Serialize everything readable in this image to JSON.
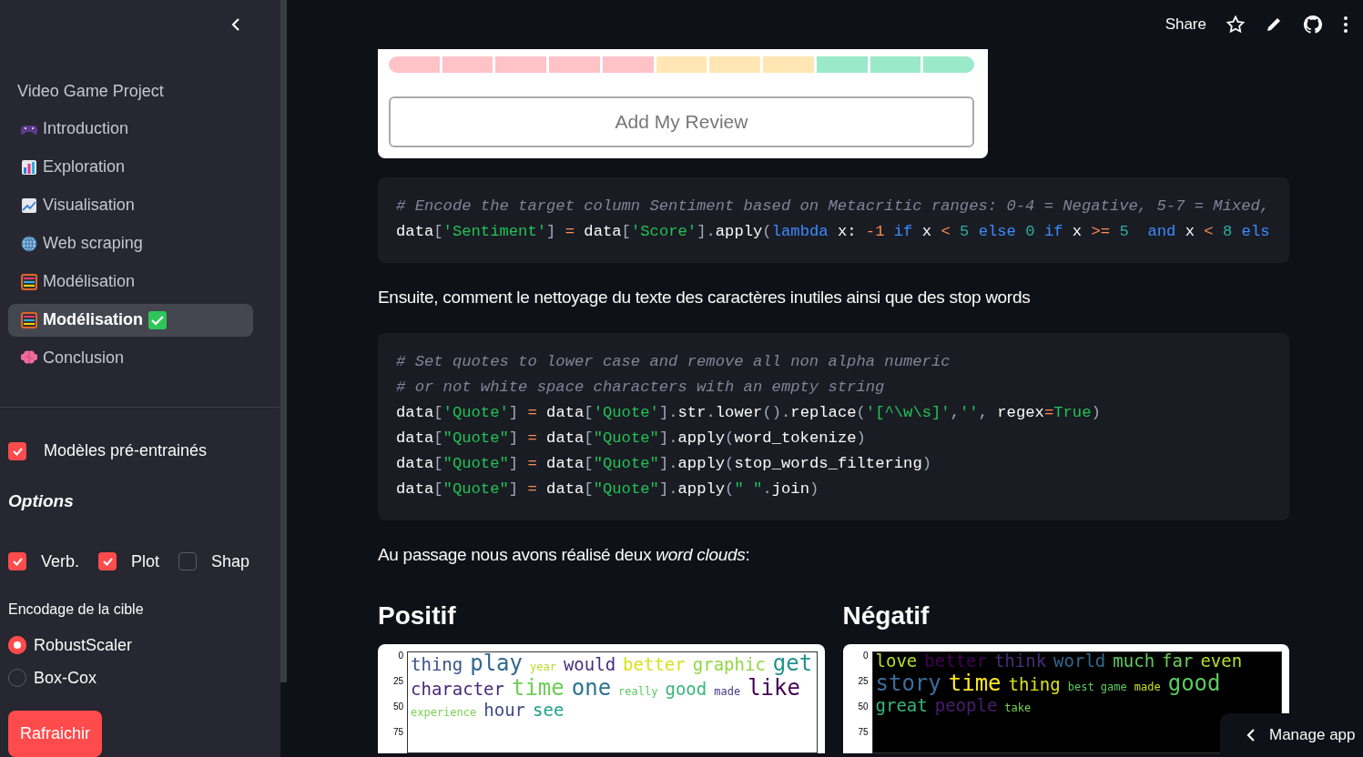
{
  "sidebar": {
    "title": "Video Game Project",
    "nav": [
      {
        "label": "Introduction",
        "selected": false,
        "done": false
      },
      {
        "label": "Exploration",
        "selected": false,
        "done": false
      },
      {
        "label": "Visualisation",
        "selected": false,
        "done": false
      },
      {
        "label": "Web scraping",
        "selected": false,
        "done": false
      },
      {
        "label": "Modélisation",
        "selected": false,
        "done": false
      },
      {
        "label": "Modélisation",
        "selected": true,
        "done": true
      },
      {
        "label": "Conclusion",
        "selected": false,
        "done": false
      }
    ],
    "pretrained": {
      "label": "Modèles pré-entrainés",
      "checked": true
    },
    "options_title": "Options",
    "options": [
      {
        "label": "Verb.",
        "checked": true
      },
      {
        "label": "Plot",
        "checked": true
      },
      {
        "label": "Shap",
        "checked": false
      }
    ],
    "encoding": {
      "label": "Encodage de la cible",
      "choices": [
        {
          "label": "RobustScaler",
          "selected": true
        },
        {
          "label": "Box-Cox",
          "selected": false
        }
      ]
    },
    "refresh_button": "Rafraichir"
  },
  "header": {
    "share": "Share"
  },
  "review": {
    "segments": [
      {
        "color": "#ffc2c7"
      },
      {
        "color": "#ffc2c7"
      },
      {
        "color": "#ffc2c7"
      },
      {
        "color": "#ffc2c7"
      },
      {
        "color": "#ffc2c7"
      },
      {
        "color": "#ffe6b3"
      },
      {
        "color": "#ffe6b3"
      },
      {
        "color": "#ffe6b3"
      },
      {
        "color": "#9ae9c9"
      },
      {
        "color": "#9ae9c9"
      },
      {
        "color": "#9ae9c9"
      }
    ],
    "button": "Add My Review"
  },
  "code_blocks": [
    {
      "lines": [
        [
          {
            "kind": "comment",
            "text": "# Encode the target column Sentiment based on Metacritic ranges: 0-4 = Negative, 5-7 = Mixed,"
          }
        ],
        [
          {
            "kind": "name",
            "text": "data"
          },
          {
            "kind": "punct",
            "text": "["
          },
          {
            "kind": "string",
            "text": "'Sentiment'"
          },
          {
            "kind": "punct",
            "text": "]"
          },
          {
            "kind": "op",
            "text": " = "
          },
          {
            "kind": "name",
            "text": "data"
          },
          {
            "kind": "punct",
            "text": "["
          },
          {
            "kind": "string",
            "text": "'Score'"
          },
          {
            "kind": "punct",
            "text": "]."
          },
          {
            "kind": "name",
            "text": "apply"
          },
          {
            "kind": "punct",
            "text": "("
          },
          {
            "kind": "keyword",
            "text": "lambda"
          },
          {
            "kind": "name",
            "text": " x: "
          },
          {
            "kind": "op",
            "text": "-1"
          },
          {
            "kind": "keyword",
            "text": " if"
          },
          {
            "kind": "name",
            "text": " x "
          },
          {
            "kind": "op",
            "text": "<"
          },
          {
            "kind": "number",
            "text": " 5"
          },
          {
            "kind": "keyword",
            "text": " else"
          },
          {
            "kind": "number",
            "text": " 0"
          },
          {
            "kind": "keyword",
            "text": " if"
          },
          {
            "kind": "name",
            "text": " x "
          },
          {
            "kind": "op",
            "text": ">="
          },
          {
            "kind": "number",
            "text": " 5"
          },
          {
            "kind": "keyword",
            "text": "  and"
          },
          {
            "kind": "name",
            "text": " x "
          },
          {
            "kind": "op",
            "text": "<"
          },
          {
            "kind": "number",
            "text": " 8"
          },
          {
            "kind": "keyword",
            "text": " els"
          }
        ]
      ]
    },
    {
      "lines": [
        [
          {
            "kind": "comment",
            "text": "# Set quotes to lower case and remove all non alpha numeric"
          }
        ],
        [
          {
            "kind": "comment",
            "text": "# or not white space characters with an empty string"
          }
        ],
        [
          {
            "kind": "name",
            "text": "data"
          },
          {
            "kind": "punct",
            "text": "["
          },
          {
            "kind": "string",
            "text": "'Quote'"
          },
          {
            "kind": "punct",
            "text": "]"
          },
          {
            "kind": "op",
            "text": " = "
          },
          {
            "kind": "name",
            "text": "data"
          },
          {
            "kind": "punct",
            "text": "["
          },
          {
            "kind": "string",
            "text": "'Quote'"
          },
          {
            "kind": "punct",
            "text": "]."
          },
          {
            "kind": "name",
            "text": "str"
          },
          {
            "kind": "punct",
            "text": "."
          },
          {
            "kind": "name",
            "text": "lower"
          },
          {
            "kind": "punct",
            "text": "()."
          },
          {
            "kind": "name",
            "text": "replace"
          },
          {
            "kind": "punct",
            "text": "("
          },
          {
            "kind": "string",
            "text": "'[^\\w\\s]'"
          },
          {
            "kind": "punct",
            "text": ","
          },
          {
            "kind": "string",
            "text": "''"
          },
          {
            "kind": "punct",
            "text": ", "
          },
          {
            "kind": "name",
            "text": "regex"
          },
          {
            "kind": "op",
            "text": "="
          },
          {
            "kind": "string",
            "text": "True"
          },
          {
            "kind": "punct",
            "text": ")"
          }
        ],
        [
          {
            "kind": "name",
            "text": "data"
          },
          {
            "kind": "punct",
            "text": "["
          },
          {
            "kind": "string",
            "text": "\"Quote\""
          },
          {
            "kind": "punct",
            "text": "]"
          },
          {
            "kind": "op",
            "text": " = "
          },
          {
            "kind": "name",
            "text": "data"
          },
          {
            "kind": "punct",
            "text": "["
          },
          {
            "kind": "string",
            "text": "\"Quote\""
          },
          {
            "kind": "punct",
            "text": "]."
          },
          {
            "kind": "name",
            "text": "apply"
          },
          {
            "kind": "punct",
            "text": "("
          },
          {
            "kind": "name",
            "text": "word_tokenize"
          },
          {
            "kind": "punct",
            "text": ")"
          }
        ],
        [
          {
            "kind": "name",
            "text": "data"
          },
          {
            "kind": "punct",
            "text": "["
          },
          {
            "kind": "string",
            "text": "\"Quote\""
          },
          {
            "kind": "punct",
            "text": "]"
          },
          {
            "kind": "op",
            "text": " = "
          },
          {
            "kind": "name",
            "text": "data"
          },
          {
            "kind": "punct",
            "text": "["
          },
          {
            "kind": "string",
            "text": "\"Quote\""
          },
          {
            "kind": "punct",
            "text": "]."
          },
          {
            "kind": "name",
            "text": "apply"
          },
          {
            "kind": "punct",
            "text": "("
          },
          {
            "kind": "name",
            "text": "stop_words_filtering"
          },
          {
            "kind": "punct",
            "text": ")"
          }
        ],
        [
          {
            "kind": "name",
            "text": "data"
          },
          {
            "kind": "punct",
            "text": "["
          },
          {
            "kind": "string",
            "text": "\"Quote\""
          },
          {
            "kind": "punct",
            "text": "]"
          },
          {
            "kind": "op",
            "text": " = "
          },
          {
            "kind": "name",
            "text": "data"
          },
          {
            "kind": "punct",
            "text": "["
          },
          {
            "kind": "string",
            "text": "\"Quote\""
          },
          {
            "kind": "punct",
            "text": "]."
          },
          {
            "kind": "name",
            "text": "apply"
          },
          {
            "kind": "punct",
            "text": "("
          },
          {
            "kind": "string",
            "text": "\" \""
          },
          {
            "kind": "punct",
            "text": "."
          },
          {
            "kind": "name",
            "text": "join"
          },
          {
            "kind": "punct",
            "text": ")"
          }
        ]
      ]
    }
  ],
  "paragraphs": [
    "Ensuite, comment le nettoyage du texte des caractères inutiles ainsi que des stop words",
    "Au passage nous avons réalisé deux *word clouds*:"
  ],
  "wordclouds": [
    {
      "heading": "Positif",
      "ticks": [
        "0",
        "25",
        "50",
        "75"
      ],
      "words": [
        {
          "text": "thing",
          "kind": "mid",
          "color": "#3b528b"
        },
        {
          "text": "play",
          "kind": "big",
          "color": "#31688e"
        },
        {
          "text": "year",
          "kind": "small",
          "color": "#b5de2b"
        },
        {
          "text": "would",
          "kind": "mid",
          "color": "#472d7b"
        },
        {
          "text": "better",
          "kind": "mid",
          "color": "#d8e219"
        },
        {
          "text": "graphic",
          "kind": "mid",
          "color": "#90d743"
        },
        {
          "text": "get",
          "kind": "big",
          "color": "#21918c"
        },
        {
          "text": "character",
          "kind": "mid",
          "color": "#482878"
        },
        {
          "text": "time",
          "kind": "big",
          "color": "#6ece58"
        },
        {
          "text": "one",
          "kind": "big",
          "color": "#2c728e"
        },
        {
          "text": "really",
          "kind": "small",
          "color": "#5ec962"
        },
        {
          "text": "good",
          "kind": "mid",
          "color": "#35b779"
        },
        {
          "text": "made",
          "kind": "small",
          "color": "#443983"
        },
        {
          "text": "like",
          "kind": "big",
          "color": "#440154"
        },
        {
          "text": "experience",
          "kind": "small",
          "color": "#7ad151"
        },
        {
          "text": "hour",
          "kind": "mid",
          "color": "#3e4989"
        },
        {
          "text": "see",
          "kind": "mid",
          "color": "#1fa187"
        }
      ]
    },
    {
      "heading": "Négatif",
      "ticks": [
        "0",
        "25",
        "50",
        "75"
      ],
      "words": [
        {
          "text": "love",
          "kind": "mid",
          "color": "#b5de2b"
        },
        {
          "text": "better",
          "kind": "mid",
          "color": "#440154"
        },
        {
          "text": "think",
          "kind": "mid",
          "color": "#472d7b"
        },
        {
          "text": "world",
          "kind": "mid",
          "color": "#31688e"
        },
        {
          "text": "much",
          "kind": "mid",
          "color": "#5ec962"
        },
        {
          "text": "far",
          "kind": "mid",
          "color": "#6ece58"
        },
        {
          "text": "even",
          "kind": "mid",
          "color": "#b5de2b"
        },
        {
          "text": "story",
          "kind": "big",
          "color": "#3b6ea0"
        },
        {
          "text": "time",
          "kind": "big",
          "color": "#fde725"
        },
        {
          "text": "thing",
          "kind": "mid",
          "color": "#d8e219"
        },
        {
          "text": "best game",
          "kind": "small",
          "color": "#5ec962"
        },
        {
          "text": "made",
          "kind": "small",
          "color": "#c8e020"
        },
        {
          "text": "good",
          "kind": "big",
          "color": "#5ec962"
        },
        {
          "text": "great",
          "kind": "mid",
          "color": "#35b779"
        },
        {
          "text": "people",
          "kind": "mid",
          "color": "#481f70"
        },
        {
          "text": "take",
          "kind": "small",
          "color": "#7ad151"
        }
      ]
    }
  ],
  "manage_app": "Manage app"
}
